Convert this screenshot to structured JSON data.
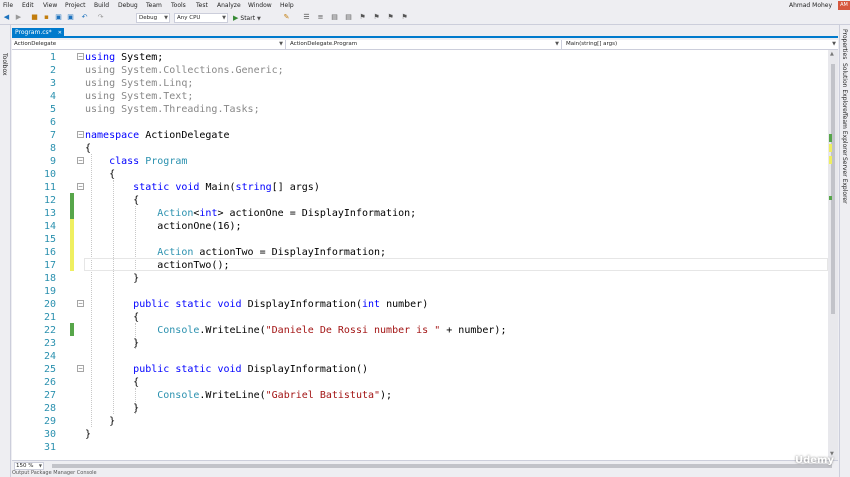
{
  "menu": [
    "File",
    "Edit",
    "View",
    "Project",
    "Build",
    "Debug",
    "Team",
    "Tools",
    "Test",
    "Analyze",
    "Window",
    "Help"
  ],
  "user": {
    "name": "Ahmad Mohey",
    "initials": "AM"
  },
  "toolbar": {
    "config": "Debug",
    "platform": "Any CPU",
    "start_label": "Start"
  },
  "left_panel": {
    "label": "Toolbox"
  },
  "right_panels": [
    "Properties",
    "Solution Explorer",
    "Team Explorer",
    "Server Explorer"
  ],
  "doc_tab": {
    "label": "Program.cs*"
  },
  "nav": {
    "project": "ActionDelegate",
    "type": "ActionDelegate.Program",
    "member": "Main(string[] args)"
  },
  "zoom": "150 %",
  "bottom_tabs": "Output   Package Manager Console",
  "watermark": "Udemy",
  "colors": {
    "accent": "#007acc",
    "keyword": "#0000ff",
    "type": "#2b91af",
    "string": "#a31515",
    "changed_saved": "#57a64a",
    "changed_unsaved": "#efef60"
  },
  "code_lines": [
    {
      "n": "1",
      "html": "<span class='k'>using</span> System;"
    },
    {
      "n": "2",
      "html": "<span class='g'>using System.Collections.Generic;</span>"
    },
    {
      "n": "3",
      "html": "<span class='g'>using System.Linq;</span>"
    },
    {
      "n": "4",
      "html": "<span class='g'>using System.Text;</span>"
    },
    {
      "n": "5",
      "html": "<span class='g'>using System.Threading.Tasks;</span>"
    },
    {
      "n": "6",
      "html": ""
    },
    {
      "n": "7",
      "html": "<span class='k'>namespace</span> ActionDelegate"
    },
    {
      "n": "8",
      "html": "{"
    },
    {
      "n": "9",
      "html": "    <span class='k'>class</span> <span class='t'>Program</span>"
    },
    {
      "n": "10",
      "html": "    {"
    },
    {
      "n": "11",
      "html": "        <span class='k'>static</span> <span class='k'>void</span> Main(<span class='k'>string</span>[] args)"
    },
    {
      "n": "12",
      "html": "        {"
    },
    {
      "n": "13",
      "html": "            <span class='t'>Action</span>&lt;<span class='k'>int</span>&gt; actionOne = DisplayInformation;"
    },
    {
      "n": "14",
      "html": "            actionOne(16);"
    },
    {
      "n": "15",
      "html": ""
    },
    {
      "n": "16",
      "html": "            <span class='t'>Action</span> actionTwo = DisplayInformation;"
    },
    {
      "n": "17",
      "html": "            actionTwo();"
    },
    {
      "n": "18",
      "html": "        }"
    },
    {
      "n": "19",
      "html": ""
    },
    {
      "n": "20",
      "html": "        <span class='k'>public</span> <span class='k'>static</span> <span class='k'>void</span> DisplayInformation(<span class='k'>int</span> number)"
    },
    {
      "n": "21",
      "html": "        {"
    },
    {
      "n": "22",
      "html": "            <span class='t'>Console</span>.WriteLine(<span class='s'>\"Daniele De Rossi number is \"</span> + number);"
    },
    {
      "n": "23",
      "html": "        }"
    },
    {
      "n": "24",
      "html": ""
    },
    {
      "n": "25",
      "html": "        <span class='k'>public</span> <span class='k'>static</span> <span class='k'>void</span> DisplayInformation()"
    },
    {
      "n": "26",
      "html": "        {"
    },
    {
      "n": "27",
      "html": "            <span class='t'>Console</span>.WriteLine(<span class='s'>\"Gabriel Batistuta\"</span>);"
    },
    {
      "n": "28",
      "html": "        }"
    },
    {
      "n": "29",
      "html": "    }"
    },
    {
      "n": "30",
      "html": "}"
    },
    {
      "n": "31",
      "html": ""
    }
  ]
}
